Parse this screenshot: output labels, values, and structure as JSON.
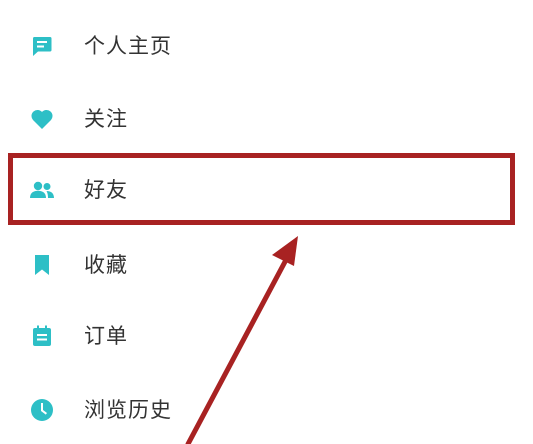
{
  "menu": {
    "items": [
      {
        "label": "个人主页",
        "icon": "profile-page-icon"
      },
      {
        "label": "关注",
        "icon": "heart-icon"
      },
      {
        "label": "好友",
        "icon": "friends-icon"
      },
      {
        "label": "收藏",
        "icon": "bookmark-icon"
      },
      {
        "label": "订单",
        "icon": "order-icon"
      },
      {
        "label": "浏览历史",
        "icon": "clock-icon"
      }
    ],
    "highlighted_item": "好友"
  },
  "colors": {
    "icon_accent": "#2dbfc6",
    "label_text": "#333333",
    "annotation_red": "#a82222",
    "background": "#ffffff"
  }
}
